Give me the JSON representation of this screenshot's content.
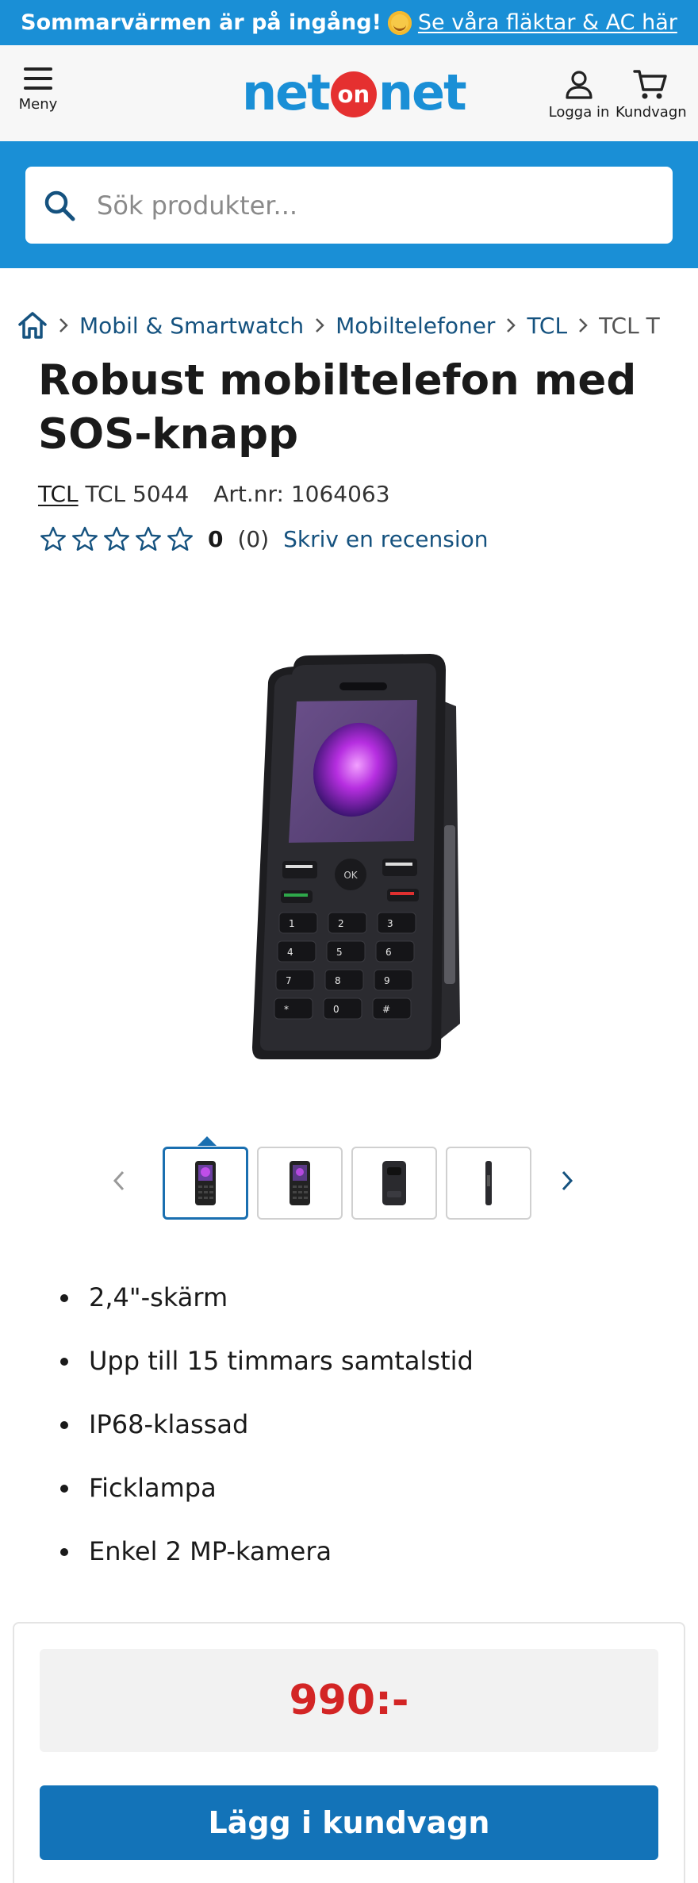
{
  "promo": {
    "text": "Sommarvärmen är på ingång!",
    "link": "Se våra fläktar & AC här"
  },
  "header": {
    "menu_label": "Meny",
    "logo": {
      "left": "net",
      "middle": "on",
      "right": "net"
    },
    "login_label": "Logga in",
    "cart_label": "Kundvagn"
  },
  "search": {
    "placeholder": "Sök produkter..."
  },
  "breadcrumb": {
    "items": [
      "Mobil & Smartwatch",
      "Mobiltelefoner",
      "TCL",
      "TCL T"
    ]
  },
  "product": {
    "title": "Robust mobiltelefon med SOS-knapp",
    "brand": "TCL",
    "model": "TCL 5044",
    "article": "Art.nr: 1064063",
    "rating_value": "0",
    "rating_count": "(0)",
    "review_link": "Skriv en recension",
    "stars_filled": 0,
    "stars_total": 5
  },
  "gallery": {
    "active_index": 0,
    "thumb_count": 4
  },
  "features": [
    "2,4\"-skärm",
    "Upp till 15 timmars samtalstid",
    "IP68-klassad",
    "Ficklampa",
    "Enkel 2 MP-kamera"
  ],
  "purchase": {
    "price": "990:-",
    "add_to_cart": "Lägg i kundvagn"
  },
  "colors": {
    "brand_blue": "#1a8fd6",
    "link_blue": "#15527f",
    "button_blue": "#1373b8",
    "price_red": "#d32525",
    "logo_red": "#e53030"
  }
}
